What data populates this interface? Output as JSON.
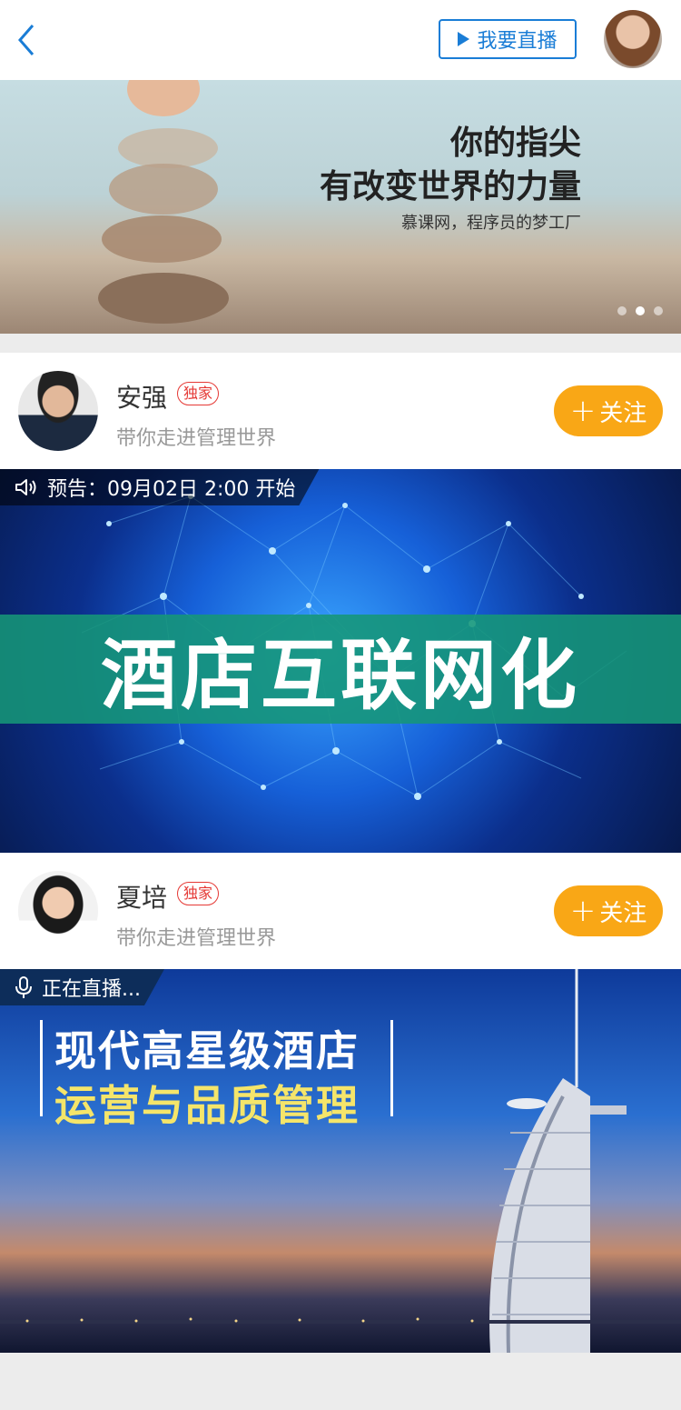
{
  "header": {
    "back_icon": "chevron-left-icon",
    "live_button_label": "我要直播",
    "live_button_icon": "play-icon",
    "accent_color": "#1a7dd6"
  },
  "banner": {
    "headline_line1": "你的指尖",
    "headline_line2": "有改变世界的力量",
    "subtitle": "慕课网，程序员的梦工厂",
    "dot_count": 3,
    "active_dot": 2
  },
  "lecturers": [
    {
      "name": "安强",
      "badge": "独家",
      "description": "带你走进管理世界",
      "follow_label": "关注",
      "course": {
        "status_icon": "speaker-icon",
        "status_text": "预告：09月02日 2:00 开始",
        "title": "酒店互联网化"
      }
    },
    {
      "name": "夏培",
      "badge": "独家",
      "description": "带你走进管理世界",
      "follow_label": "关注",
      "course": {
        "status_icon": "microphone-icon",
        "status_text": "正在直播...",
        "title_line1": "现代高星级酒店",
        "title_line2": "运营与品质管理"
      }
    }
  ],
  "colors": {
    "follow_button": "#f9a716",
    "badge": "#e53935"
  }
}
